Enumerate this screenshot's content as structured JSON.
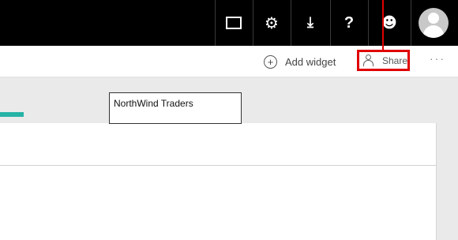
{
  "topbar": {
    "icons": [
      "fullscreen-icon",
      "gear-icon",
      "download-icon",
      "help-icon",
      "feedback-icon",
      "avatar"
    ],
    "help_glyph": "?"
  },
  "actionbar": {
    "add_widget_label": "Add widget",
    "share_label": "Share",
    "more_label": "···"
  },
  "canvas": {
    "tile_title": "NorthWind Traders"
  },
  "colors": {
    "topbar": "#000000",
    "highlight": "#e00000",
    "accent": "#26b3a6"
  }
}
